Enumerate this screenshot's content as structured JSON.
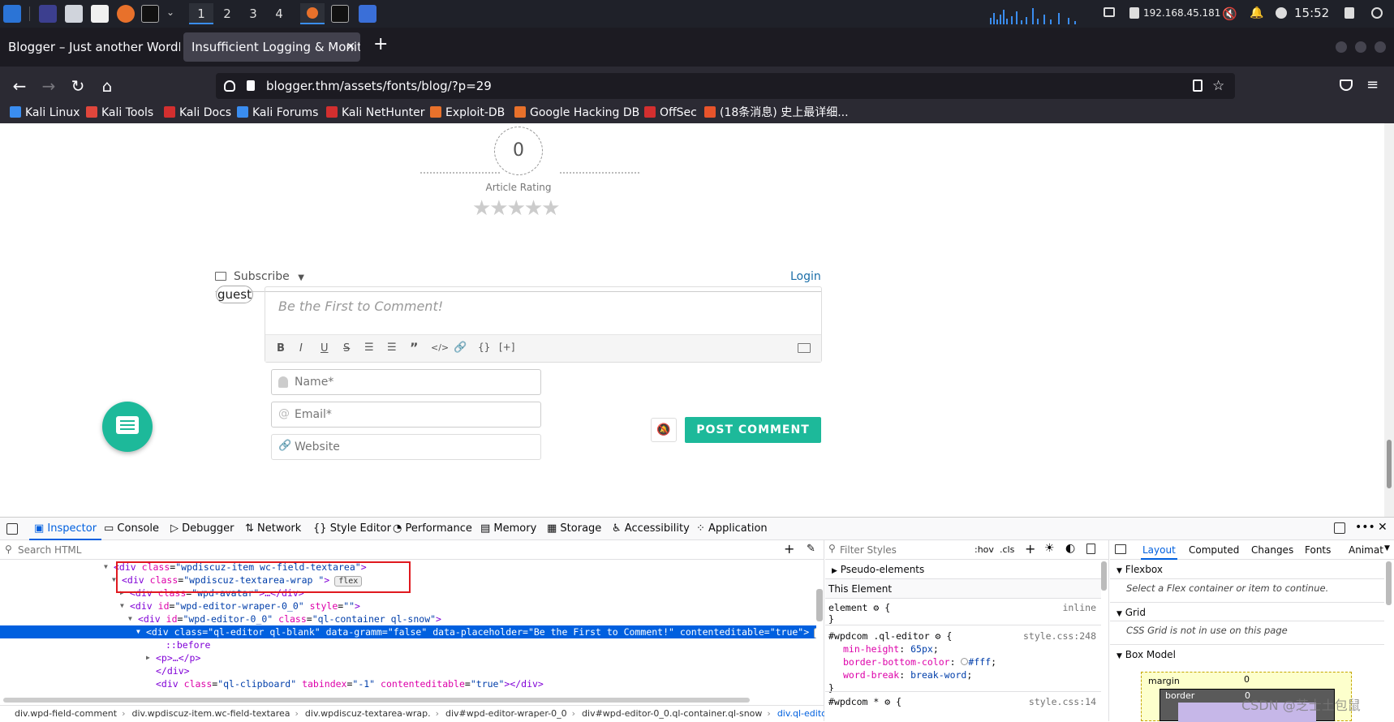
{
  "taskbar": {
    "workspaces": [
      "1",
      "2",
      "3",
      "4"
    ],
    "ip": "192.168.45.181",
    "time": "15:52"
  },
  "tabs": [
    {
      "label": "Blogger – Just another WordPress site"
    },
    {
      "label": "Insufficient Logging & Monitoring"
    }
  ],
  "url": "blogger.thm/assets/fonts/blog/?p=29",
  "bookmarks": [
    {
      "label": "Kali Linux",
      "color": "#3a8df0"
    },
    {
      "label": "Kali Tools",
      "color": "#e0463c"
    },
    {
      "label": "Kali Docs",
      "color": "#d32f2f"
    },
    {
      "label": "Kali Forums",
      "color": "#3a8df0"
    },
    {
      "label": "Kali NetHunter",
      "color": "#d32f2f"
    },
    {
      "label": "Exploit-DB",
      "color": "#e8712b"
    },
    {
      "label": "Google Hacking DB",
      "color": "#e8712b"
    },
    {
      "label": "OffSec",
      "color": "#d32f2f"
    },
    {
      "label": "(18条消息) 史上最详细...",
      "color": "#e8542b"
    }
  ],
  "page": {
    "rating_value": "0",
    "rating_label": "Article Rating",
    "subscribe_label": "Subscribe",
    "login_label": "Login",
    "guest_label": "guest",
    "comment_placeholder": "Be the First to Comment!",
    "name_placeholder": "Name*",
    "email_placeholder": "Email*",
    "website_placeholder": "Website",
    "post_button": "POST COMMENT",
    "accent": "#1db99a"
  },
  "devtools": {
    "tabs": [
      "Inspector",
      "Console",
      "Debugger",
      "Network",
      "Style Editor",
      "Performance",
      "Memory",
      "Storage",
      "Accessibility",
      "Application"
    ],
    "search_placeholder": "Search HTML",
    "filter_placeholder": "Filter Styles",
    "hov": ":hov",
    "cls": ".cls",
    "html_lines": [
      {
        "tag": "<div",
        "attrs": [
          [
            "class",
            "wpdiscuz-item wc-field-textarea"
          ]
        ],
        "tail": ">",
        "badge": ""
      },
      {
        "tag": "<div",
        "attrs": [
          [
            "class",
            "wpdiscuz-textarea-wrap "
          ]
        ],
        "tail": ">",
        "badge": "flex"
      },
      {
        "tag": "<div",
        "attrs": [
          [
            "class",
            "wpd-avatar"
          ]
        ],
        "tail": ">…</div>",
        "badge": ""
      },
      {
        "tag": "<div",
        "attrs": [
          [
            "id",
            "wpd-editor-wraper-0_0"
          ],
          [
            "style",
            ""
          ]
        ],
        "tail": ">",
        "badge": ""
      },
      {
        "tag": "<div",
        "attrs": [
          [
            "id",
            "wpd-editor-0_0"
          ],
          [
            "class",
            "ql-container ql-snow"
          ]
        ],
        "tail": ">",
        "badge": ""
      },
      {
        "tag": "<div",
        "attrs": [
          [
            "class",
            "ql-editor ql-blank"
          ],
          [
            "data-gramm",
            "false"
          ],
          [
            "data-placeholder",
            "Be the First to Comment!"
          ],
          [
            "contenteditable",
            "true"
          ]
        ],
        "tail": ">",
        "badge": "event"
      },
      {
        "tag": "::before",
        "attrs": [],
        "tail": "",
        "badge": ""
      },
      {
        "tag": "<p>",
        "attrs": [],
        "tail": "…</p>",
        "badge": ""
      },
      {
        "tag": "</div>",
        "attrs": [],
        "tail": "",
        "badge": ""
      },
      {
        "tag": "<div",
        "attrs": [
          [
            "class",
            "ql-clipboard"
          ],
          [
            "tabindex",
            "-1"
          ],
          [
            "contenteditable",
            "true"
          ]
        ],
        "tail": "></div>",
        "badge": ""
      }
    ],
    "breadcrumbs": [
      "div.wpd-field-comment",
      "div.wpdiscuz-item.wc-field-textarea",
      "div.wpdiscuz-textarea-wrap.",
      "div#wpd-editor-wraper-0_0",
      "div#wpd-editor-0_0.ql-container.ql-snow",
      "div.ql-editor.ql-blank"
    ],
    "rules": {
      "pseudo": "Pseudo-elements",
      "this_element": "This Element",
      "element_sel": "element",
      "element_src": "inline",
      "rule1_sel": "#wpdcom .ql-editor",
      "rule1_src": "style.css:248",
      "rule1_props": [
        [
          "min-height",
          "65px"
        ],
        [
          "border-bottom-color",
          "#fff"
        ],
        [
          "word-break",
          "break-word"
        ]
      ],
      "rule2_sel": "#wpdcom *",
      "rule2_src": "style.css:14"
    },
    "layout_tabs": [
      "Layout",
      "Computed",
      "Changes",
      "Fonts",
      "Animat"
    ],
    "flexbox": "Flexbox",
    "flexbox_msg": "Select a Flex container or item to continue.",
    "grid": "Grid",
    "grid_msg": "CSS Grid is not in use on this page",
    "boxmodel": "Box Model",
    "margin_label": "margin",
    "border_label": "border",
    "margin_val": "0",
    "border_val": "0"
  },
  "watermark": "CSDN @芝士土包鼠"
}
